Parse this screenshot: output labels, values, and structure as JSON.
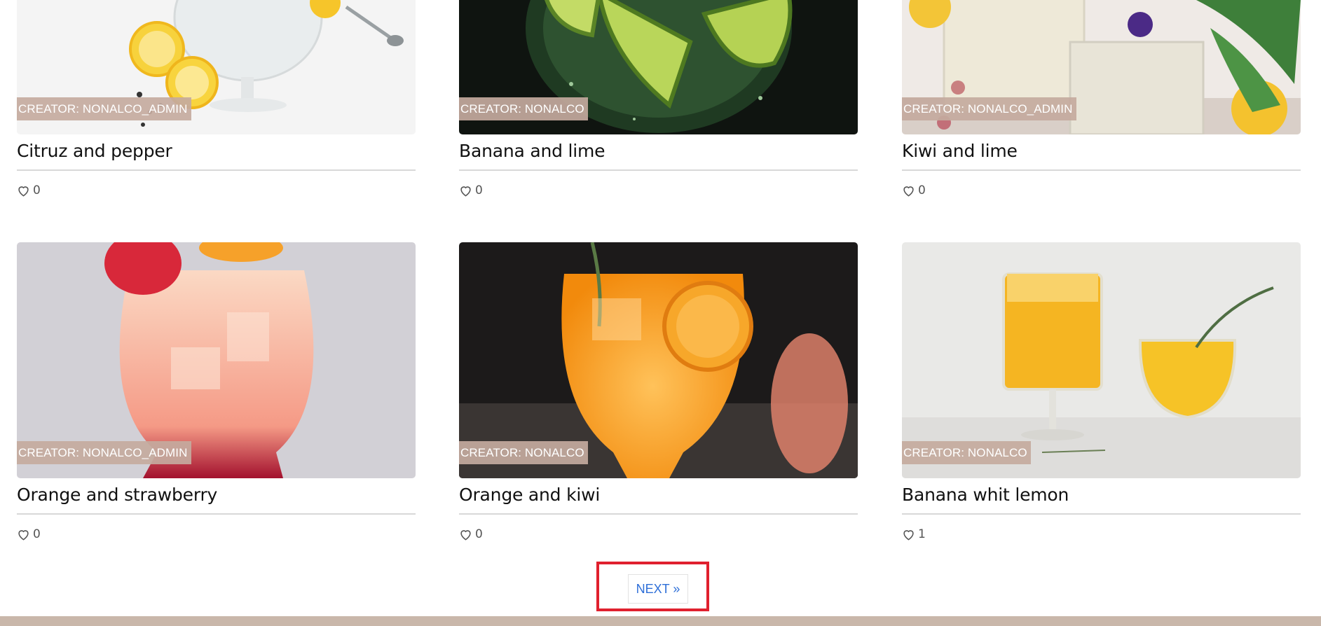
{
  "cards": [
    {
      "creator": "CREATOR: NONALCO_ADMIN",
      "title": "Citruz and pepper",
      "likes": "0"
    },
    {
      "creator": "CREATOR: NONALCO",
      "title": "Banana and lime",
      "likes": "0"
    },
    {
      "creator": "CREATOR: NONALCO_ADMIN",
      "title": "Kiwi and lime",
      "likes": "0"
    },
    {
      "creator": "CREATOR: NONALCO_ADMIN",
      "title": "Orange and strawberry",
      "likes": "0"
    },
    {
      "creator": "CREATOR: NONALCO",
      "title": "Orange and kiwi",
      "likes": "0"
    },
    {
      "creator": "CREATOR: NONALCO",
      "title": "Banana whit lemon",
      "likes": "1"
    }
  ],
  "pagination": {
    "next_label": "NEXT »"
  },
  "colors": {
    "creator_badge": "#c4aa9e",
    "next_link": "#2e6fd8",
    "highlight_box": "#e0202e",
    "footer": "#c9b7aa"
  },
  "icons": {
    "like": "heart-outline-icon"
  }
}
